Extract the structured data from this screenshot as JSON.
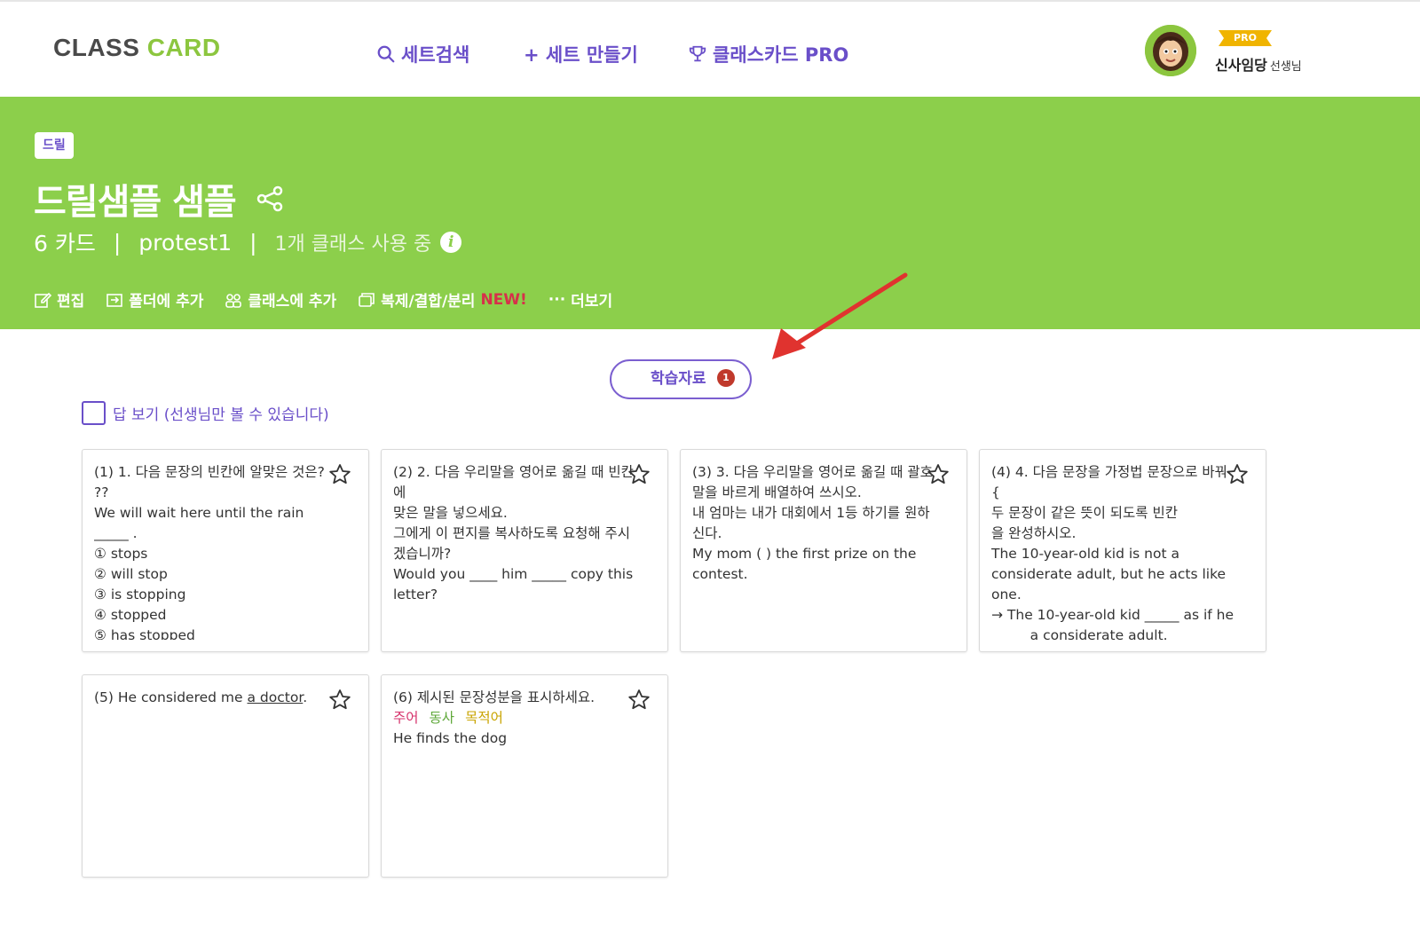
{
  "header": {
    "logo_part1": "CLASS",
    "logo_part2": "CARD",
    "nav": {
      "search": "세트검색",
      "create": "+ 세트 만들기",
      "pro": "클래스카드 PRO"
    },
    "user": {
      "badge": "PRO",
      "name": "신사임당",
      "suffix": "선생님"
    }
  },
  "banner": {
    "tag": "드릴",
    "title": "드릴샘플 샘플",
    "meta": {
      "cards": "6 카드",
      "sep": "|",
      "author": "protest1",
      "usage": "1개 클래스 사용 중"
    },
    "actions": {
      "edit": "편집",
      "folder": "폴더에 추가",
      "class": "클래스에 추가",
      "copy": "복제/결합/분리",
      "copy_new": "NEW!",
      "more": "더보기"
    }
  },
  "study": {
    "label": "학습자료",
    "count": "1"
  },
  "answer_toggle": {
    "label": "답 보기 (선생님만 볼 수 있습니다)",
    "checked": false
  },
  "cards": [
    {
      "text": "(1) 1. 다음 문장의 빈칸에 알맞은 것은? ??\nWe will wait here until the rain _____ .\n① stops\n② will stop\n③ is stopping\n④ stopped\n⑤ has stopped"
    },
    {
      "text": "(2) 2. 다음 우리말을 영어로 옮길 때 빈칸에\n맞은 말을 넣으세요.\n그에게 이 편지를 복사하도록 요청해 주시겠습니까?\nWould you ____ him _____ copy this letter?"
    },
    {
      "text": "(3) 3. 다음 우리말을 영어로 옮길 때 괄호\n말을 바르게 배열하여 쓰시오.\n내 엄마는 내가 대회에서 1등 하기를 원하신다.\nMy mom (  ) the first prize on the contest."
    },
    {
      "text": "(4) 4. 다음 문장을 가정법 문장으로 바꿔 {\n두 문장이 같은 뜻이 되도록 빈칸\n을 완성하시오.\nThe 10-year-old kid is not a considerate adult, but he acts like one.\n→ The 10-year-old kid _____ as if he _____ a considerate adult."
    },
    {
      "prefix": "(5) He considered me ",
      "underlined": "a doctor",
      "suffix": "."
    },
    {
      "line1": "(6) 제시된 문장성분을 표시하세요.",
      "roles": [
        "주어",
        "동사",
        "목적어"
      ],
      "line3": "He finds the dog"
    }
  ],
  "colors": {
    "banner": "#8ccf4b",
    "accent": "#6a4fc9",
    "new_badge": "#d6314a",
    "logo_green": "#8cc63f"
  }
}
